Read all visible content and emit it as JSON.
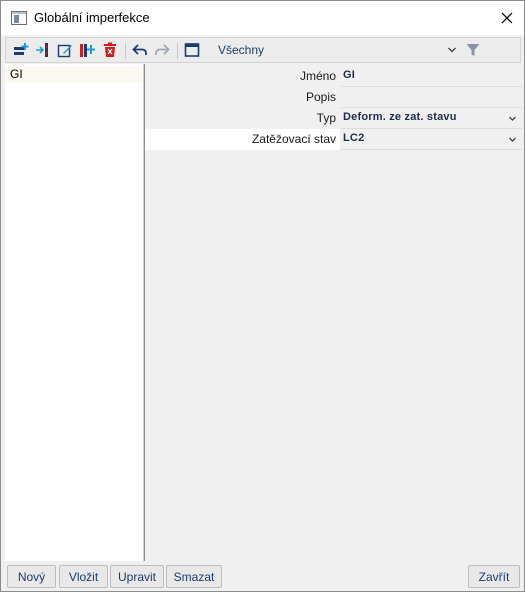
{
  "window": {
    "title": "Globální imperfekce",
    "icon": "window-app-icon",
    "close_icon": "close-icon"
  },
  "toolbar": {
    "icons": [
      "new-item-icon",
      "insert-item-icon",
      "edit-item-icon",
      "copy-item-icon",
      "delete-item-icon",
      "undo-icon",
      "redo-icon",
      "table-view-icon"
    ],
    "filter_value": "Všechny",
    "filter_icon": "funnel-icon",
    "accent": "#1d3b6e",
    "delete_color": "#d01c1c",
    "add_color": "#1f9bd1"
  },
  "list": {
    "items": [
      {
        "label": "GI",
        "selected": true
      }
    ]
  },
  "properties": [
    {
      "label": "Jméno",
      "value": "GI",
      "dropdown": false
    },
    {
      "label": "Popis",
      "value": "",
      "dropdown": false
    },
    {
      "label": "Typ",
      "value": "Deform. ze zat. stavu",
      "dropdown": true
    },
    {
      "label": "Zatěžovací stav",
      "value": "LC2",
      "dropdown": true
    }
  ],
  "buttons": {
    "new": "Nový",
    "insert": "Vložit",
    "edit": "Upravit",
    "delete": "Smazat",
    "close": "Zavřít"
  }
}
